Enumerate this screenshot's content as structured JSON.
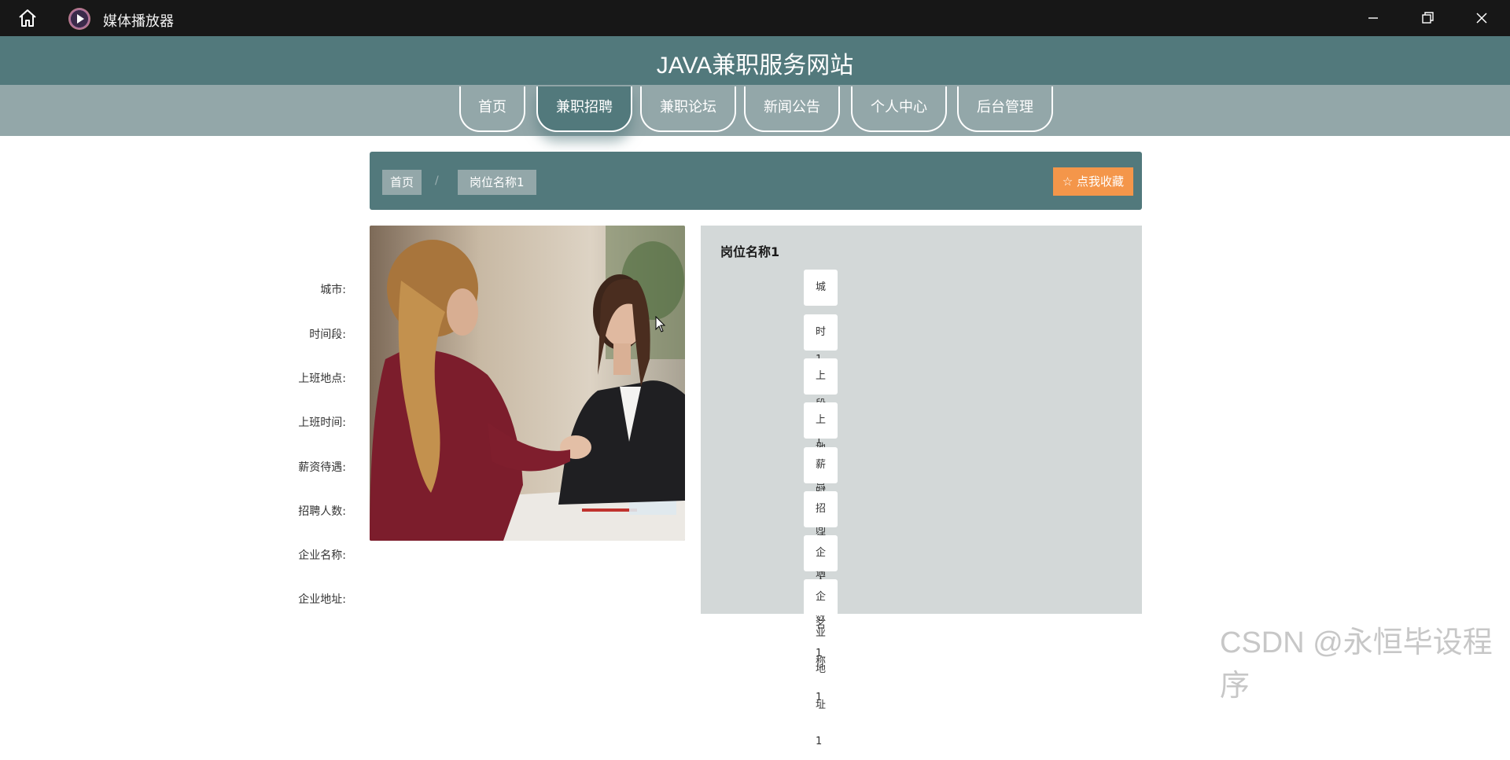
{
  "window": {
    "title": "媒体播放器",
    "icons": [
      "home-icon",
      "media-player-logo",
      "minimize-icon",
      "restore-icon",
      "close-icon"
    ]
  },
  "site": {
    "title": "JAVA兼职服务网站"
  },
  "nav": {
    "items": [
      {
        "label": "首页",
        "active": false
      },
      {
        "label": "兼职招聘",
        "active": true
      },
      {
        "label": "兼职论坛",
        "active": false
      },
      {
        "label": "新闻公告",
        "active": false
      },
      {
        "label": "个人中心",
        "active": false
      },
      {
        "label": "后台管理",
        "active": false
      }
    ]
  },
  "breadcrumb": {
    "home": "首页",
    "separator": "/",
    "current": "岗位名称1",
    "favorite_label": "☆ 点我收藏"
  },
  "detail": {
    "title": "岗位名称1",
    "fields": [
      {
        "label": "城市:",
        "value": "城市1"
      },
      {
        "label": "时间段:",
        "value": "时间段1"
      },
      {
        "label": "上班地点:",
        "value": "上班地点1"
      },
      {
        "label": "上班时间:",
        "value": "上班时间1"
      },
      {
        "label": "薪资待遇:",
        "value": "薪资待遇1"
      },
      {
        "label": "招聘人数:",
        "value": "招聘人数1"
      },
      {
        "label": "企业名称:",
        "value": "企业名称1"
      },
      {
        "label": "企业地址:",
        "value": "企业地址1"
      }
    ]
  },
  "watermark": "CSDN @永恒毕设程序",
  "colors": {
    "header": "#52797c",
    "nav_bg": "#93a7a9",
    "favorite": "#f4964a",
    "panel": "#d3d8d8"
  }
}
